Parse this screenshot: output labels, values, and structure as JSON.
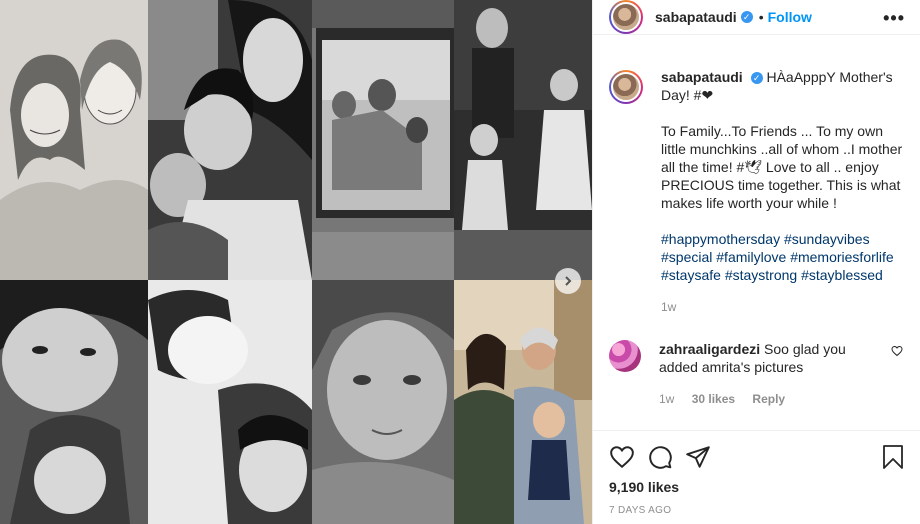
{
  "post": {
    "username": "sabapataudi",
    "follow_label": "Follow",
    "more_label": "•••",
    "caption": {
      "username": "sabapataudi",
      "title": "HÀaAppp​Y Mother's Day! #❤",
      "lines": [
        "To Family...To Friends ... To my own little munchkins ..all of whom ..I mother all the time! #🕊 Love to all .. enjoy PRECIOUS time together. This is what makes life worth your while !"
      ],
      "hashtags": [
        "#happymothersday",
        "#sundayvibes",
        "#special",
        "#familylove",
        "#memoriesforlife",
        "#staysafe",
        "#staystrong",
        "#stayblessed"
      ],
      "age": "1w"
    },
    "comment": {
      "username": "zahraaligardezi",
      "text": "Soo glad you added amrita's pictures",
      "age": "1w",
      "likes": "30 likes",
      "reply_label": "Reply"
    },
    "likes": "9,190 likes",
    "date": "7 DAYS AGO"
  },
  "icons": {
    "like": "heart-icon",
    "comment": "comment-icon",
    "share": "share-icon",
    "save": "bookmark-icon",
    "verified": "verified-badge",
    "next": "chevron-right-icon"
  },
  "colors": {
    "link": "#0095f6",
    "hashtag": "#00376b",
    "muted": "#8e8e8e",
    "text": "#262626"
  }
}
